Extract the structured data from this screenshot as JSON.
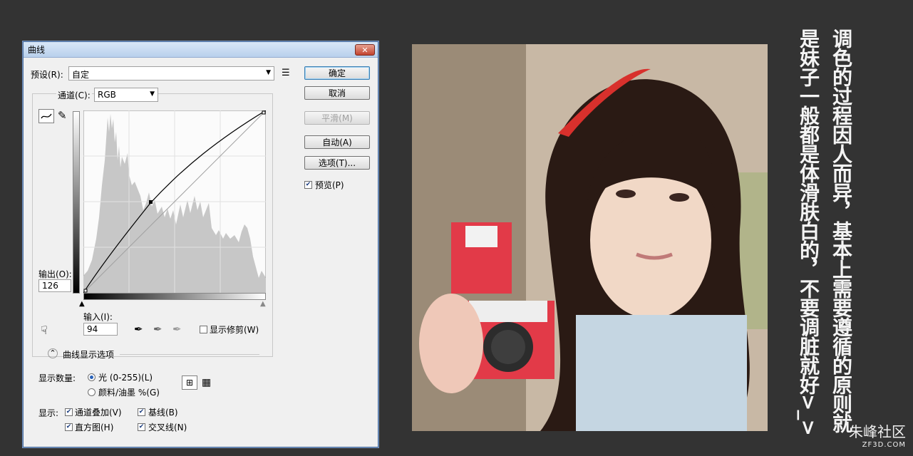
{
  "dialog": {
    "title": "曲线",
    "close_label": "✕",
    "preset_label": "预设(R):",
    "preset_value": "自定",
    "channel_label": "通道(C):",
    "channel_value": "RGB",
    "output_label": "输出(O):",
    "output_value": "126",
    "input_label": "输入(I):",
    "input_value": "94",
    "show_clipping_label": "显示修剪(W)",
    "curve_options_label": "曲线显示选项",
    "show_amount_label": "显示数量:",
    "light_option": "光 (0-255)(L)",
    "pigment_option": "颜料/油墨 %(G)",
    "show_label": "显示:",
    "channel_overlay": "通道叠加(V)",
    "baseline": "基线(B)",
    "histogram": "直方图(H)",
    "intersection": "交叉线(N)",
    "buttons": {
      "ok": "确定",
      "cancel": "取消",
      "smooth": "平滑(M)",
      "auto": "自动(A)",
      "options": "选项(T)...",
      "preview": "预览(P)"
    }
  },
  "caption": {
    "line1": "调色的过程因人而异，基本上需要遵循的原则就",
    "line2": "是妹子一般都是体滑肤白的，不要调脏就好>_>"
  },
  "watermark": {
    "name": "朱峰社区",
    "domain": "ZF3D.COM"
  }
}
